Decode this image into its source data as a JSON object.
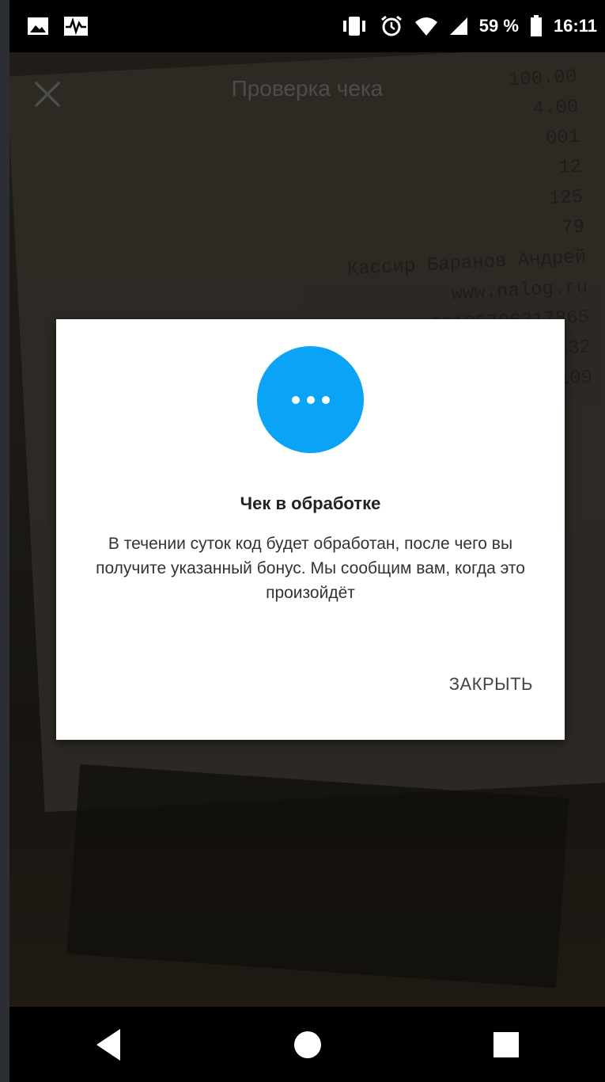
{
  "status_bar": {
    "battery_percent": "59 %",
    "time": "16:11",
    "icons": [
      "image-icon",
      "activity-icon",
      "vibrate-icon",
      "alarm-icon",
      "wifi-icon",
      "signal-icon",
      "battery-icon"
    ]
  },
  "header": {
    "title": "Проверка чека",
    "close_icon": "close-icon"
  },
  "receipt_text": {
    "lines": [
      "100.00",
      "4.00",
      "001",
      "12",
      "125",
      "79",
      "Кассир Баранов Андрей",
      "www.nalog.ru",
      "00105706317865",
      "00132",
      "00109"
    ]
  },
  "dialog": {
    "icon": "more-dots-icon",
    "title": "Чек в обработке",
    "message": "В течении суток код будет обработан, после чего вы получите указанный бонус. Мы сообщим вам, когда это произойдёт",
    "button_label": "ЗАКРЫТЬ"
  },
  "nav_bar": {
    "icons": [
      "back-icon",
      "home-icon",
      "recents-icon"
    ]
  },
  "colors": {
    "accent": "#0aa3f5",
    "dialog_bg": "#ffffff",
    "status_bar_bg": "#000000"
  }
}
